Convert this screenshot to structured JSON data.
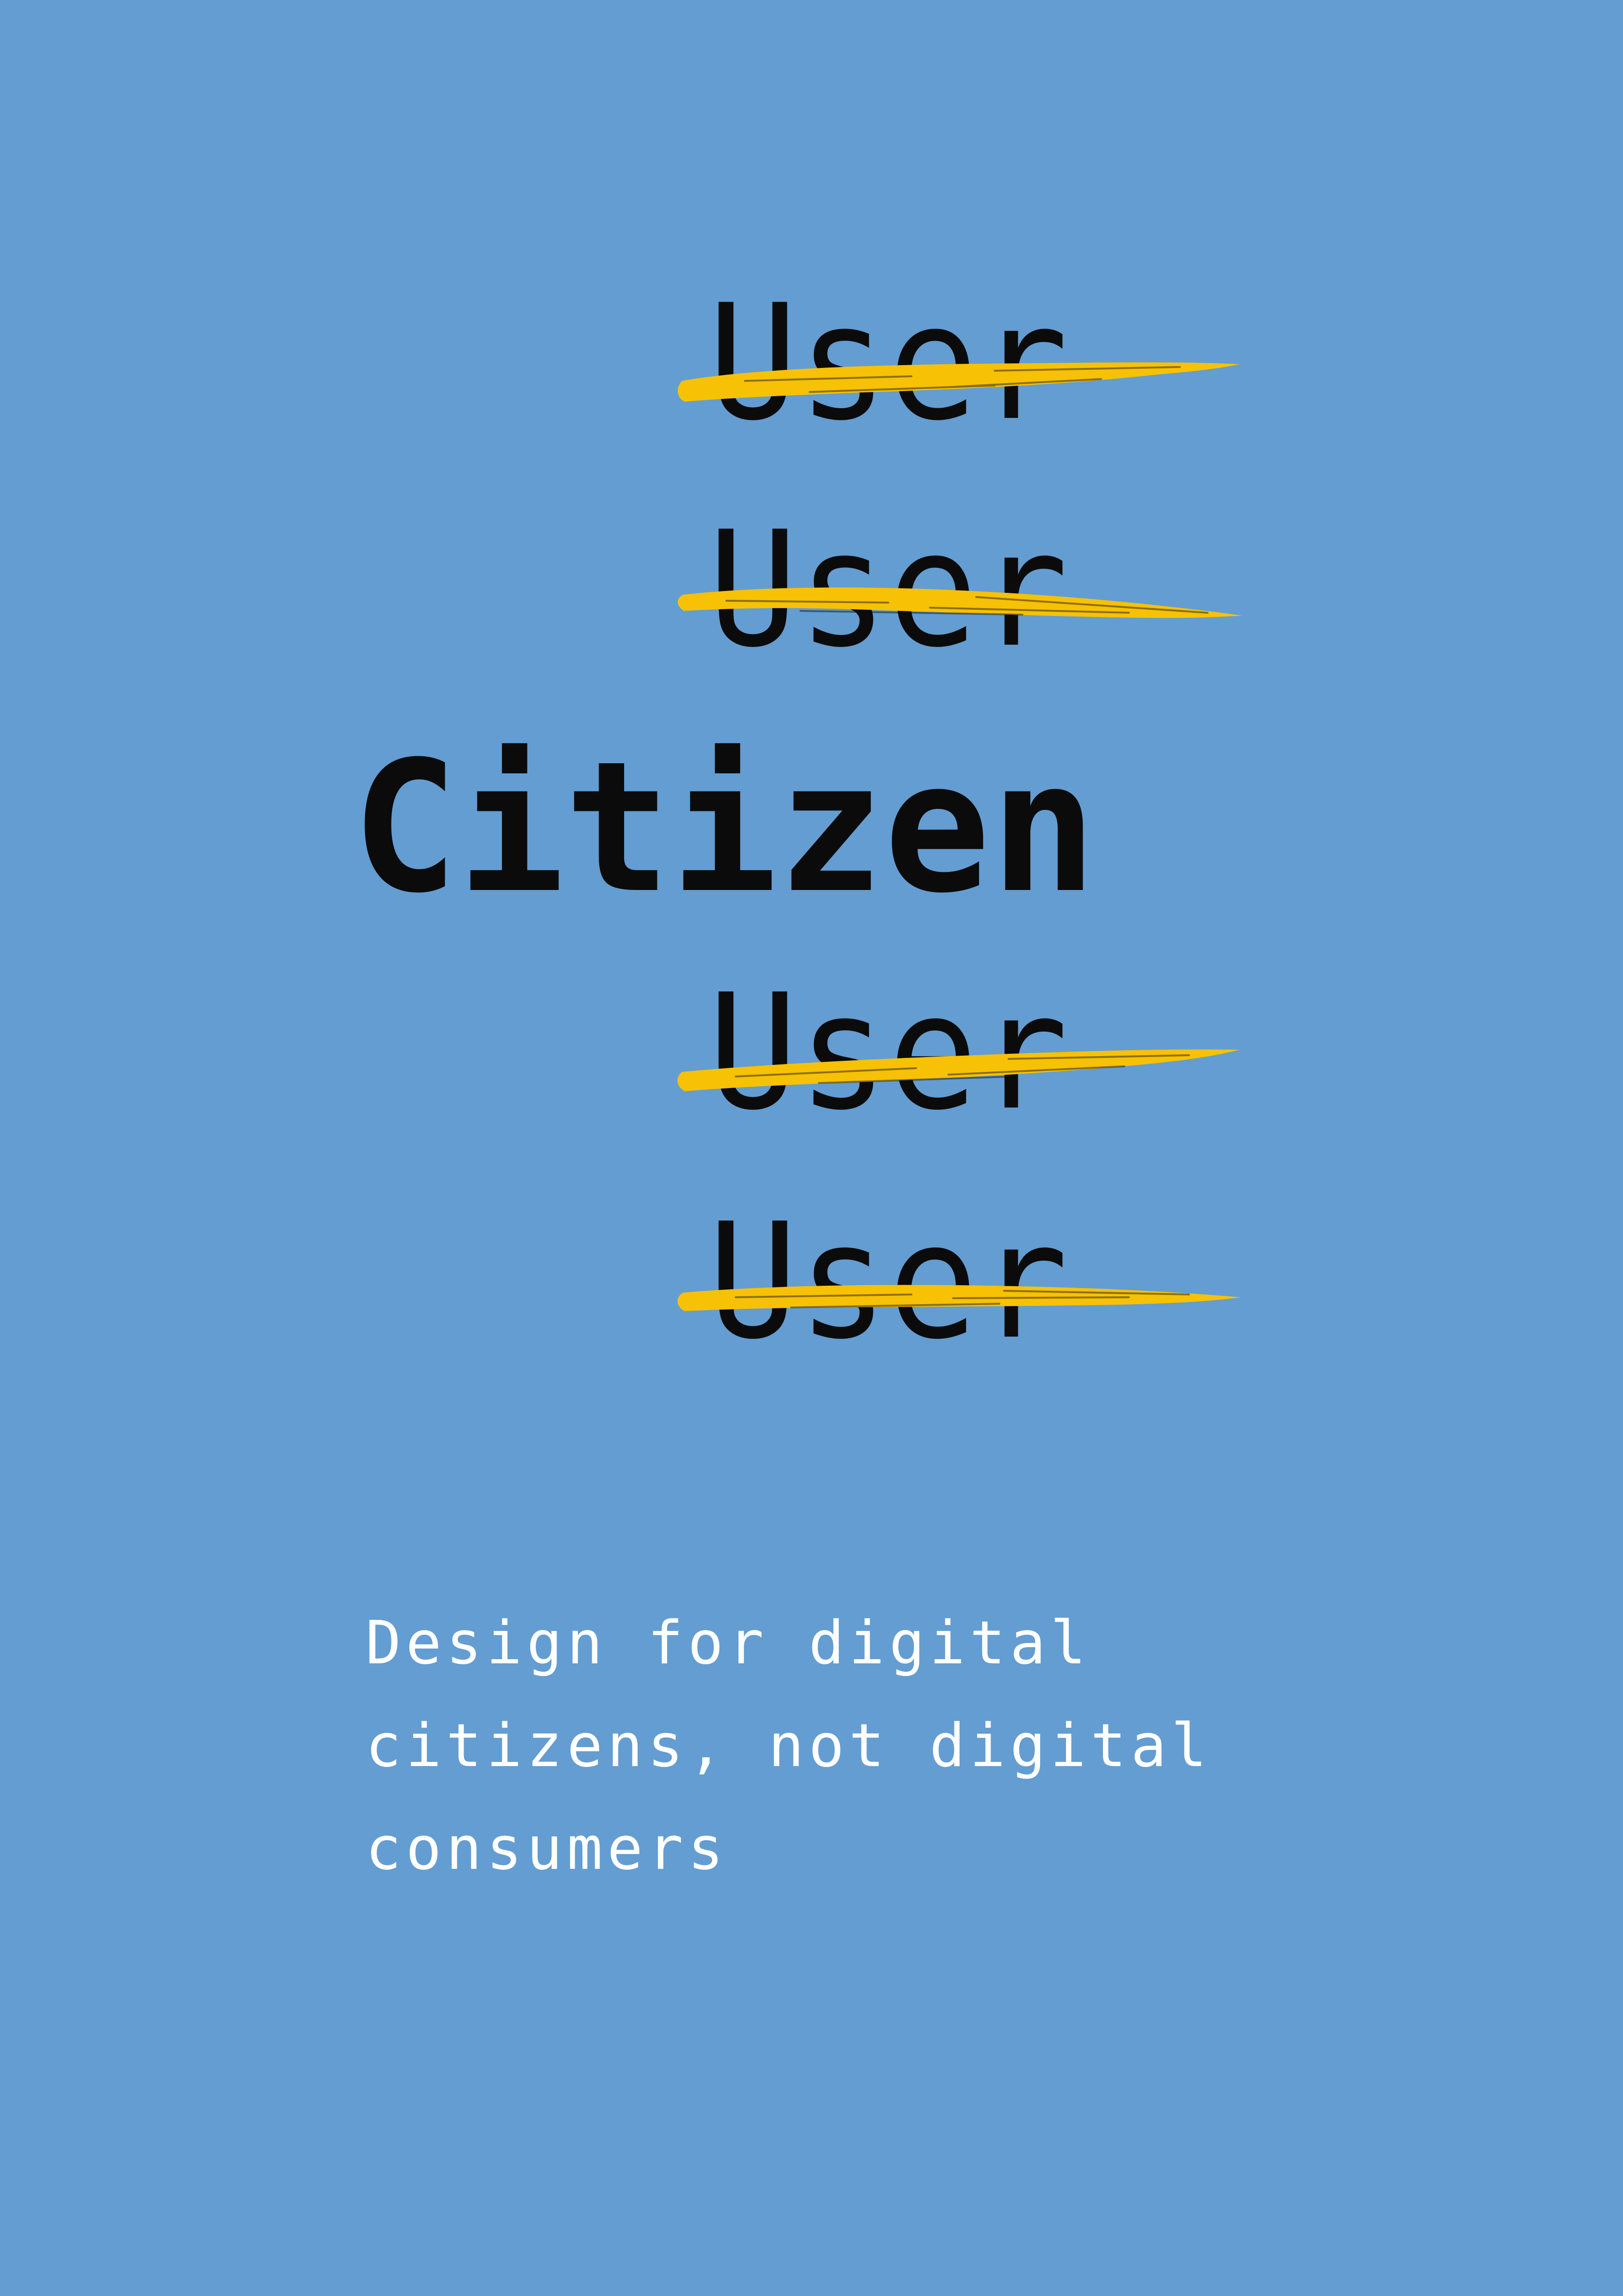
{
  "poster": {
    "background_color": "#639dd2",
    "text_color": "#0b0b0b",
    "highlight_color": "#f7c105",
    "tagline_color": "#ffffff",
    "crossed_words": [
      {
        "text": "User"
      },
      {
        "text": "User"
      },
      {
        "text": "User"
      },
      {
        "text": "User"
      }
    ],
    "main_word": "Citizen",
    "tagline_lines": [
      "Design for digital",
      "citizens, not digital",
      "consumers"
    ]
  }
}
